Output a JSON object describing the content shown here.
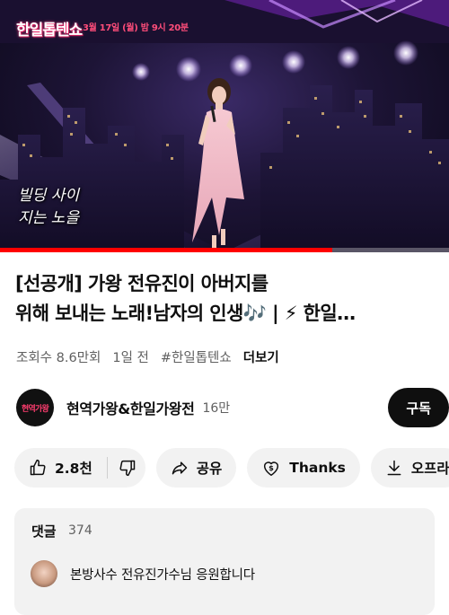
{
  "video": {
    "show_logo": "한일톱텐쇼",
    "air_info": "3월 17일 (월) 밤 9시 20분",
    "caption_lines": [
      "빌딩 사이",
      "지는 노을"
    ],
    "progress_fraction": 0.74
  },
  "title": {
    "line1": "[선공개] 가왕 전유진이 아버지를",
    "line2": "위해 보내는 노래!남자의 인생🎶 | ⚡ 한일…"
  },
  "meta": {
    "views": "조회수 8.6만회",
    "age": "1일 전",
    "hashtag": "#한일톱텐쇼",
    "more": "더보기"
  },
  "channel": {
    "avatar_text": "현역가왕",
    "name": "현역가왕&한일가왕전",
    "subscribers": "16만",
    "subscribe_label": "구독"
  },
  "actions": {
    "like_count": "2.8천",
    "share_label": "공유",
    "thanks_label": "Thanks",
    "offline_label": "오프라"
  },
  "comments": {
    "header": "댓글",
    "count": "374",
    "top_comment": "본방사수 전유진가수님 응원합니다"
  },
  "colors": {
    "accent_red": "#ff0000",
    "pill_bg": "#f2f2f2",
    "subscribe_bg": "#0f0f0f"
  },
  "icons": [
    "thumbs-up-icon",
    "thumbs-down-icon",
    "share-icon",
    "thanks-icon",
    "download-icon"
  ]
}
